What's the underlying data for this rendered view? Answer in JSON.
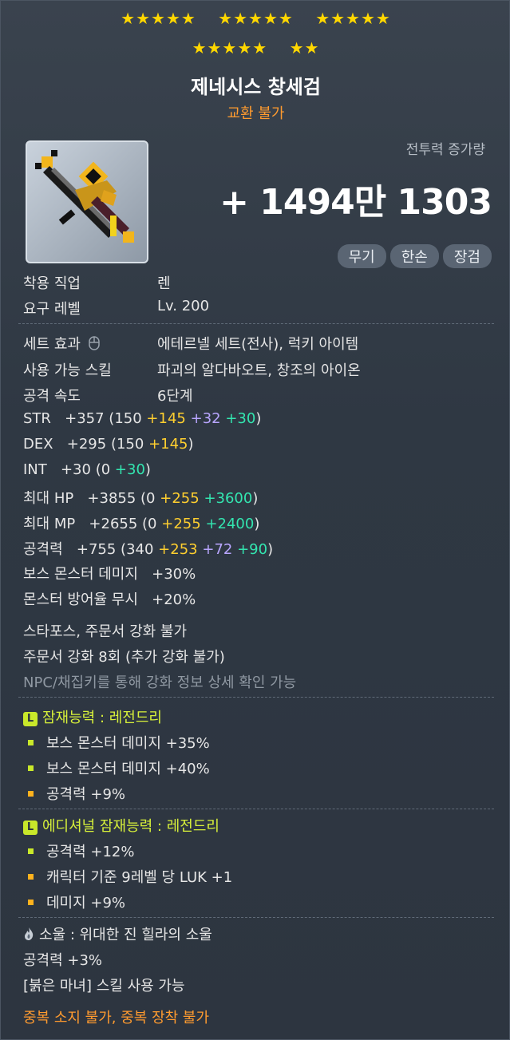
{
  "stars": {
    "row1": [
      "★★★★★",
      "★★★★★",
      "★★★★★"
    ],
    "row2": [
      "★★★★★",
      "★★"
    ]
  },
  "item": {
    "name": "제네시스 창세검",
    "tradable": "교환 불가"
  },
  "combat_power": {
    "label": "전투력 증가량",
    "value": "+ 1494만 1303"
  },
  "tags": [
    "무기",
    "한손",
    "장검"
  ],
  "requirements": [
    {
      "label": "착용 직업",
      "value": "렌"
    },
    {
      "label": "요구 레벨",
      "value": "Lv. 200"
    }
  ],
  "info": [
    {
      "label": "세트 효과",
      "value": "에테르넬 세트(전사), 럭키 아이템"
    },
    {
      "label": "사용 가능 스킬",
      "value": "파괴의 알다바오트, 창조의 아이온"
    },
    {
      "label": "공격 속도",
      "value": "6단계"
    }
  ],
  "stats": [
    {
      "label": "STR",
      "total": "+357",
      "open": "(150",
      "parts": [
        {
          "t": "+145",
          "c": "y"
        },
        {
          "t": "+32",
          "c": "p"
        },
        {
          "t": "+30",
          "c": "g"
        }
      ]
    },
    {
      "label": "DEX",
      "total": "+295",
      "open": "(150",
      "parts": [
        {
          "t": "+145",
          "c": "y"
        }
      ]
    },
    {
      "label": "INT",
      "total": "+30",
      "open": "(0",
      "parts": [
        {
          "t": "+30",
          "c": "g"
        }
      ]
    },
    {
      "label": "최대 HP",
      "total": "+3855",
      "open": "(0",
      "parts": [
        {
          "t": "+255",
          "c": "y"
        },
        {
          "t": "+3600",
          "c": "g"
        }
      ]
    },
    {
      "label": "최대 MP",
      "total": "+2655",
      "open": "(0",
      "parts": [
        {
          "t": "+255",
          "c": "y"
        },
        {
          "t": "+2400",
          "c": "g"
        }
      ]
    },
    {
      "label": "공격력",
      "total": "+755",
      "open": "(340",
      "parts": [
        {
          "t": "+253",
          "c": "y"
        },
        {
          "t": "+72",
          "c": "p"
        },
        {
          "t": "+90",
          "c": "g"
        }
      ]
    }
  ],
  "extra_stats": [
    {
      "label": "보스 몬스터 데미지",
      "value": "+30%"
    },
    {
      "label": "몬스터 방어율 무시",
      "value": "+20%"
    }
  ],
  "notes": [
    "스타포스, 주문서 강화 불가",
    "주문서 강화 8회 (추가 강화 불가)"
  ],
  "note_gray": "NPC/채집키를 통해 강화 정보 상세 확인 가능",
  "potential": {
    "badge": "L",
    "title": "잠재능력 : 레전드리",
    "lines": [
      {
        "text": "보스 몬스터 데미지 +35%",
        "color": "green"
      },
      {
        "text": "보스 몬스터 데미지 +40%",
        "color": "green"
      },
      {
        "text": "공격력 +9%",
        "color": "orange"
      }
    ]
  },
  "additional": {
    "badge": "L",
    "title": "에디셔널 잠재능력 : 레전드리",
    "lines": [
      {
        "text": "공격력 +12%",
        "color": "green"
      },
      {
        "text": "캐릭터 기준 9레벨 당 LUK +1",
        "color": "orange"
      },
      {
        "text": "데미지 +9%",
        "color": "orange"
      }
    ]
  },
  "soul": {
    "title": "소울 : 위대한 진 힐라의 소울",
    "stat": "공격력 +3%",
    "skill": "[붉은 마녀] 스킬 사용 가능"
  },
  "footer": "중복 소지 불가, 중복 장착 불가",
  "colors": {
    "star": "#ffd700",
    "title_orange": "#ff9b2f",
    "legend_green": "#c9e82a"
  },
  "icons": [
    "sword-icon",
    "mouse-icon",
    "flame-icon"
  ]
}
